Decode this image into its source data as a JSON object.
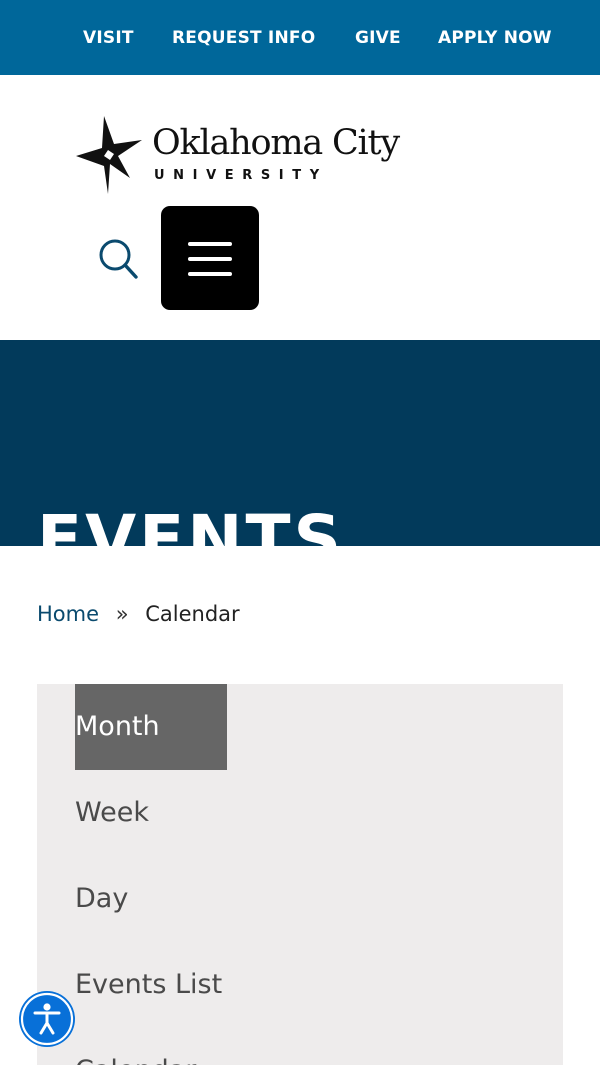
{
  "topnav": {
    "visit": "VISIT",
    "request_info": "REQUEST INFO",
    "give": "GIVE",
    "apply_now": "APPLY NOW"
  },
  "logo": {
    "name": "Oklahoma City",
    "sub": "UNIVERSITY"
  },
  "header": {
    "search_icon": "search-icon",
    "menu_icon": "hamburger-icon"
  },
  "hero": {
    "title": "EVENTS"
  },
  "breadcrumb": {
    "home": "Home",
    "separator": "»",
    "current": "Calendar"
  },
  "views": {
    "items": [
      "Month",
      "Week",
      "Day",
      "Events List",
      "Calendar"
    ],
    "active": "Month"
  },
  "accessibility": {
    "icon": "accessibility-icon"
  },
  "colors": {
    "topbar": "#00679a",
    "hero": "#023a5b",
    "panel": "#eeecec",
    "active_view": "#666666",
    "a11y": "#0870d8"
  }
}
